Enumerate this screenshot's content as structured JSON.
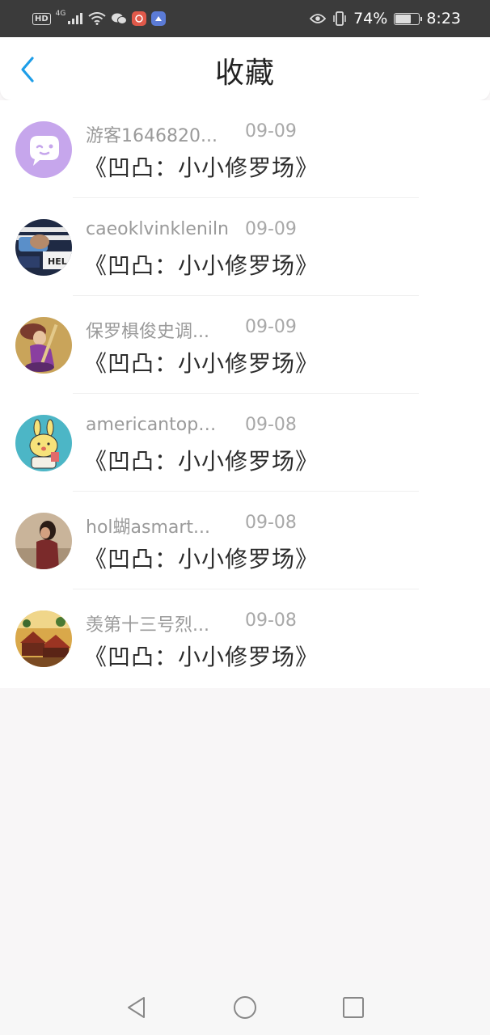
{
  "status_bar": {
    "left_indicators": {
      "hd": "HD",
      "network": "4G"
    },
    "battery_percent": "74%",
    "battery_level": 0.74,
    "time": "8:23",
    "icons": [
      "signal-icon",
      "wifi-icon",
      "wechat-icon",
      "app-icon",
      "app-icon",
      "eye-icon",
      "vibrate-icon",
      "battery-icon"
    ]
  },
  "header": {
    "title": "收藏",
    "back_icon": "chevron-left-icon",
    "accent_color": "#1e9ee8"
  },
  "favorites": [
    {
      "username": "游客1646820...",
      "date": "09-09",
      "title": "《凹凸：小小修罗场》",
      "avatar": "chat-bubble-avatar"
    },
    {
      "username": "caeoklvinkleniln",
      "date": "09-09",
      "title": "《凹凸：小小修罗场》",
      "avatar": "photo-avatar"
    },
    {
      "username": "保罗椇俊史调...",
      "date": "09-09",
      "title": "《凹凸：小小修罗场》",
      "avatar": "game-character-avatar"
    },
    {
      "username": "americantopu...",
      "date": "09-08",
      "title": "《凹凸：小小修罗场》",
      "avatar": "cartoon-rabbit-avatar"
    },
    {
      "username": "hol蝴asmart...",
      "date": "09-08",
      "title": "《凹凸：小小修罗场》",
      "avatar": "person-photo-avatar"
    },
    {
      "username": "羡第十三号烈...",
      "date": "09-08",
      "title": "《凹凸：小小修罗场》",
      "avatar": "scenery-avatar"
    }
  ],
  "nav_bar": {
    "icons": [
      "back-triangle-icon",
      "home-circle-icon",
      "recents-square-icon"
    ]
  }
}
